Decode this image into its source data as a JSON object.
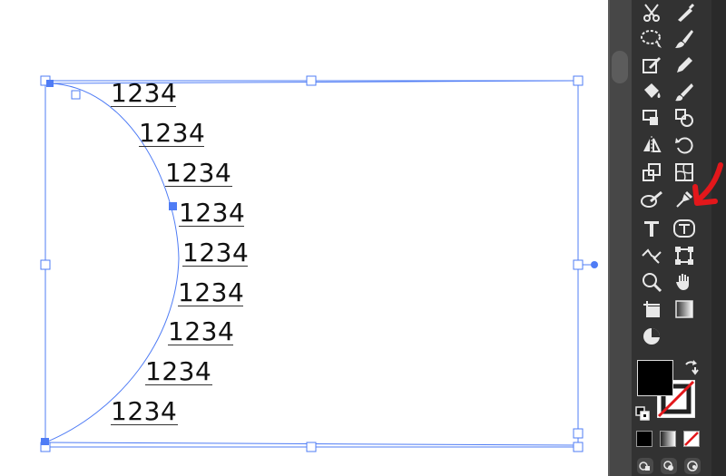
{
  "canvas": {
    "rows": [
      "1234",
      "1234",
      "1234",
      "1234",
      "1234",
      "1234",
      "1234",
      "1234",
      "1234"
    ]
  },
  "colors": {
    "selection_blue": "#4f7cf5",
    "toolbar_bg": "#323232",
    "icon_color": "#e8e8e8",
    "annotation_red": "#e3171b"
  },
  "toolbar": {
    "tools": [
      {
        "name": "scissors-icon"
      },
      {
        "name": "eraser-icon"
      },
      {
        "name": "lasso-icon"
      },
      {
        "name": "paintbrush-icon"
      },
      {
        "name": "shaper-icon"
      },
      {
        "name": "pencil-icon"
      },
      {
        "name": "live-paint-bucket-icon"
      },
      {
        "name": "blob-brush-icon"
      },
      {
        "name": "perspective-icon"
      },
      {
        "name": "shape-builder-icon"
      },
      {
        "name": "reflect-icon"
      },
      {
        "name": "rotate-icon"
      },
      {
        "name": "scale-icon"
      },
      {
        "name": "mesh-icon"
      },
      {
        "name": "width-icon"
      },
      {
        "name": "puppet-warp-icon"
      },
      {
        "name": "type-icon"
      },
      {
        "name": "touch-type-icon"
      },
      {
        "name": "type-on-path-icon"
      },
      {
        "name": "free-transform-icon"
      },
      {
        "name": "zoom-icon"
      },
      {
        "name": "hand-icon"
      },
      {
        "name": "artboard-icon"
      },
      {
        "name": "gradient-icon"
      },
      {
        "name": "pie-chart-icon"
      }
    ]
  }
}
